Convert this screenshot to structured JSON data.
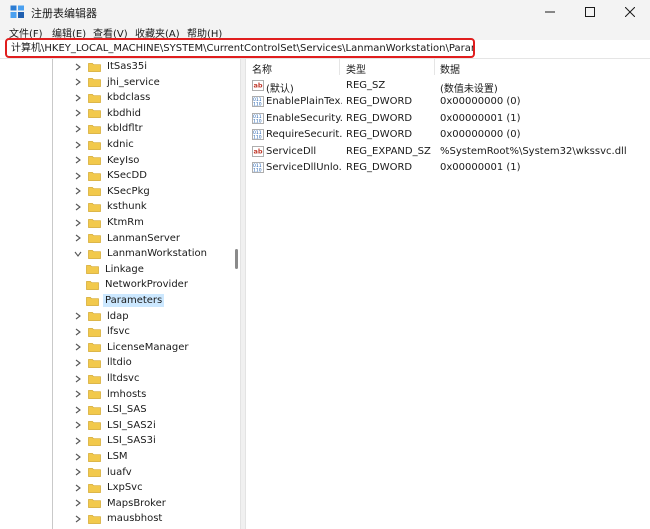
{
  "window": {
    "title": "注册表编辑器",
    "controls": [
      "minimize-icon",
      "maximize-icon",
      "close-icon"
    ]
  },
  "menu": [
    "文件(F)",
    "编辑(E)",
    "查看(V)",
    "收藏夹(A)",
    "帮助(H)"
  ],
  "address": "计算机\\HKEY_LOCAL_MACHINE\\SYSTEM\\CurrentControlSet\\Services\\LanmanWorkstation\\Parameters",
  "tree": [
    {
      "label": "ItSas35i",
      "level": 0,
      "expander": "collapsed"
    },
    {
      "label": "jhi_service",
      "level": 0,
      "expander": "collapsed"
    },
    {
      "label": "kbdclass",
      "level": 0,
      "expander": "collapsed"
    },
    {
      "label": "kbdhid",
      "level": 0,
      "expander": "collapsed"
    },
    {
      "label": "kbldfltr",
      "level": 0,
      "expander": "collapsed"
    },
    {
      "label": "kdnic",
      "level": 0,
      "expander": "collapsed"
    },
    {
      "label": "KeyIso",
      "level": 0,
      "expander": "collapsed"
    },
    {
      "label": "KSecDD",
      "level": 0,
      "expander": "collapsed"
    },
    {
      "label": "KSecPkg",
      "level": 0,
      "expander": "collapsed"
    },
    {
      "label": "ksthunk",
      "level": 0,
      "expander": "collapsed"
    },
    {
      "label": "KtmRm",
      "level": 0,
      "expander": "collapsed"
    },
    {
      "label": "LanmanServer",
      "level": 0,
      "expander": "collapsed"
    },
    {
      "label": "LanmanWorkstation",
      "level": 0,
      "expander": "expanded"
    },
    {
      "label": "Linkage",
      "level": 1,
      "expander": "none"
    },
    {
      "label": "NetworkProvider",
      "level": 1,
      "expander": "none"
    },
    {
      "label": "Parameters",
      "level": 1,
      "expander": "none",
      "selected": true
    },
    {
      "label": "ldap",
      "level": 0,
      "expander": "collapsed"
    },
    {
      "label": "lfsvc",
      "level": 0,
      "expander": "collapsed"
    },
    {
      "label": "LicenseManager",
      "level": 0,
      "expander": "collapsed"
    },
    {
      "label": "lltdio",
      "level": 0,
      "expander": "collapsed"
    },
    {
      "label": "lltdsvc",
      "level": 0,
      "expander": "collapsed"
    },
    {
      "label": "lmhosts",
      "level": 0,
      "expander": "collapsed"
    },
    {
      "label": "LSI_SAS",
      "level": 0,
      "expander": "collapsed"
    },
    {
      "label": "LSI_SAS2i",
      "level": 0,
      "expander": "collapsed"
    },
    {
      "label": "LSI_SAS3i",
      "level": 0,
      "expander": "collapsed"
    },
    {
      "label": "LSM",
      "level": 0,
      "expander": "collapsed"
    },
    {
      "label": "luafv",
      "level": 0,
      "expander": "collapsed"
    },
    {
      "label": "LxpSvc",
      "level": 0,
      "expander": "collapsed"
    },
    {
      "label": "MapsBroker",
      "level": 0,
      "expander": "collapsed"
    },
    {
      "label": "mausbhost",
      "level": 0,
      "expander": "collapsed"
    }
  ],
  "values": {
    "columns": [
      "名称",
      "类型",
      "数据"
    ],
    "rows": [
      {
        "icon": "string-value-icon",
        "name": "(默认)",
        "type": "REG_SZ",
        "data": "(数值未设置)"
      },
      {
        "icon": "binary-value-icon",
        "name": "EnablePlainTex...",
        "type": "REG_DWORD",
        "data": "0x00000000 (0)"
      },
      {
        "icon": "binary-value-icon",
        "name": "EnableSecurity...",
        "type": "REG_DWORD",
        "data": "0x00000001 (1)"
      },
      {
        "icon": "binary-value-icon",
        "name": "RequireSecurit...",
        "type": "REG_DWORD",
        "data": "0x00000000 (0)"
      },
      {
        "icon": "string-value-icon",
        "name": "ServiceDll",
        "type": "REG_EXPAND_SZ",
        "data": "%SystemRoot%\\System32\\wkssvc.dll"
      },
      {
        "icon": "binary-value-icon",
        "name": "ServiceDllUnlo...",
        "type": "REG_DWORD",
        "data": "0x00000001 (1)"
      }
    ]
  },
  "colors": {
    "highlight_border": "#e01e1e",
    "selection": "#cce8ff",
    "folder": "#f2c94c"
  }
}
